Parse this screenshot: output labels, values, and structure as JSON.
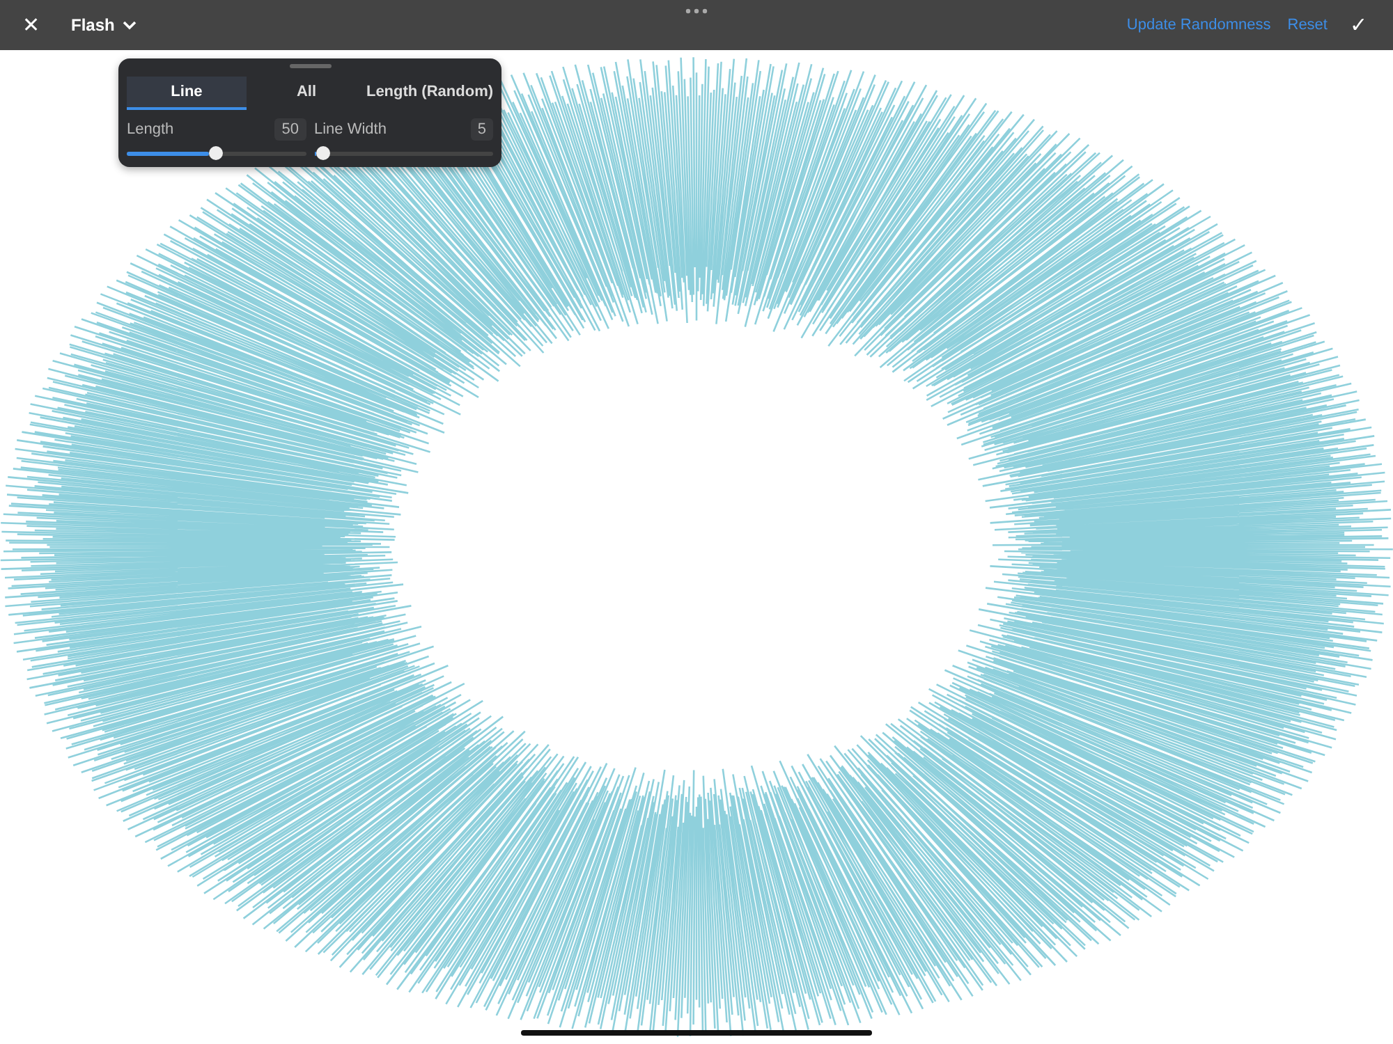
{
  "top_bar": {
    "close": "✕",
    "title": "Flash",
    "actions": [
      "Update Randomness",
      "Reset"
    ],
    "confirm": "✓"
  },
  "panel": {
    "tabs": [
      {
        "label": "Line",
        "selected": true
      },
      {
        "label": "All",
        "selected": false
      },
      {
        "label": "Length (Random)",
        "selected": false
      }
    ],
    "sliders": [
      {
        "label": "Length",
        "reading": "50",
        "level": 0.5
      },
      {
        "label": "Line Width",
        "reading": "5",
        "level": 0.05
      }
    ]
  }
}
